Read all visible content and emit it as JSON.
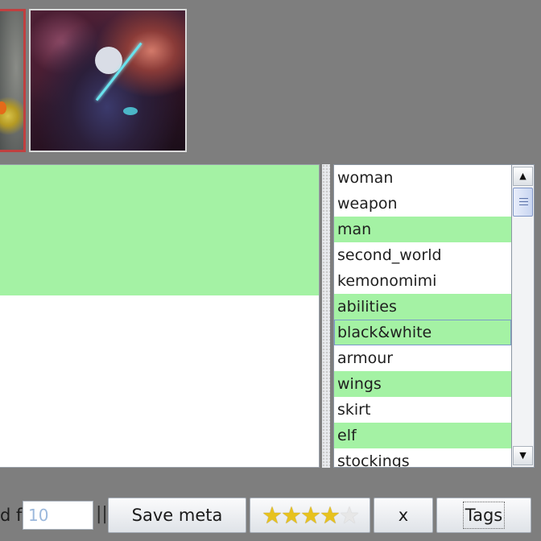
{
  "tags": {
    "items": [
      {
        "label": "woman",
        "selected": false
      },
      {
        "label": "weapon",
        "selected": false
      },
      {
        "label": "man",
        "selected": true
      },
      {
        "label": "second_world",
        "selected": false
      },
      {
        "label": "kemonomimi",
        "selected": false
      },
      {
        "label": "abilities",
        "selected": true
      },
      {
        "label": "black&white",
        "selected": true,
        "focused": true
      },
      {
        "label": "armour",
        "selected": false
      },
      {
        "label": "wings",
        "selected": true
      },
      {
        "label": "skirt",
        "selected": false
      },
      {
        "label": "elf",
        "selected": true
      },
      {
        "label": "stockings",
        "selected": false
      }
    ]
  },
  "toolbar": {
    "label_fragment": "d f",
    "count_value": "10",
    "separator": "||",
    "save_meta_label": "Save meta",
    "rating": 4,
    "rating_max": 5,
    "clear_label": "x",
    "tags_label": "Tags"
  },
  "colors": {
    "background": "#7e7e7e",
    "selection_green": "#a4f2a4",
    "star_on": "#e7c21e",
    "star_off": "#e7e7e7"
  }
}
